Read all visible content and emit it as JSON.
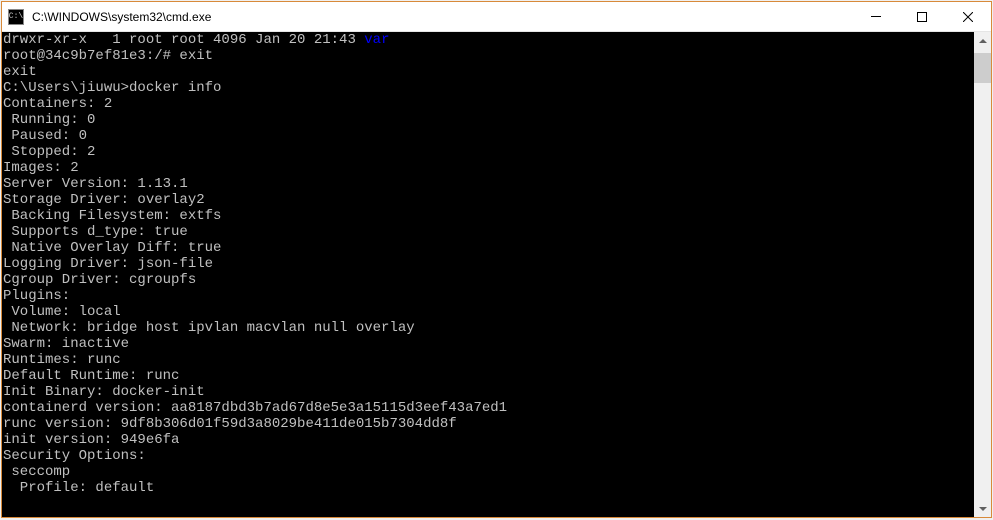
{
  "window": {
    "title": "C:\\WINDOWS\\system32\\cmd.exe",
    "icon_label": "C:\\"
  },
  "terminal": {
    "lines": [
      {
        "pre": "drwxr-xr-x   1 root root 4096 Jan 20 21:43 ",
        "link": "var"
      },
      {
        "pre": "root@34c9b7ef81e3:/# exit"
      },
      {
        "pre": "exit"
      },
      {
        "pre": ""
      },
      {
        "pre": "C:\\Users\\jiuwu>docker info"
      },
      {
        "pre": "Containers: 2"
      },
      {
        "pre": " Running: 0"
      },
      {
        "pre": " Paused: 0"
      },
      {
        "pre": " Stopped: 2"
      },
      {
        "pre": "Images: 2"
      },
      {
        "pre": "Server Version: 1.13.1"
      },
      {
        "pre": "Storage Driver: overlay2"
      },
      {
        "pre": " Backing Filesystem: extfs"
      },
      {
        "pre": " Supports d_type: true"
      },
      {
        "pre": " Native Overlay Diff: true"
      },
      {
        "pre": "Logging Driver: json-file"
      },
      {
        "pre": "Cgroup Driver: cgroupfs"
      },
      {
        "pre": "Plugins:"
      },
      {
        "pre": " Volume: local"
      },
      {
        "pre": " Network: bridge host ipvlan macvlan null overlay"
      },
      {
        "pre": "Swarm: inactive"
      },
      {
        "pre": "Runtimes: runc"
      },
      {
        "pre": "Default Runtime: runc"
      },
      {
        "pre": "Init Binary: docker-init"
      },
      {
        "pre": "containerd version: aa8187dbd3b7ad67d8e5e3a15115d3eef43a7ed1"
      },
      {
        "pre": "runc version: 9df8b306d01f59d3a8029be411de015b7304dd8f"
      },
      {
        "pre": "init version: 949e6fa"
      },
      {
        "pre": "Security Options:"
      },
      {
        "pre": " seccomp"
      },
      {
        "pre": "  Profile: default"
      }
    ]
  }
}
